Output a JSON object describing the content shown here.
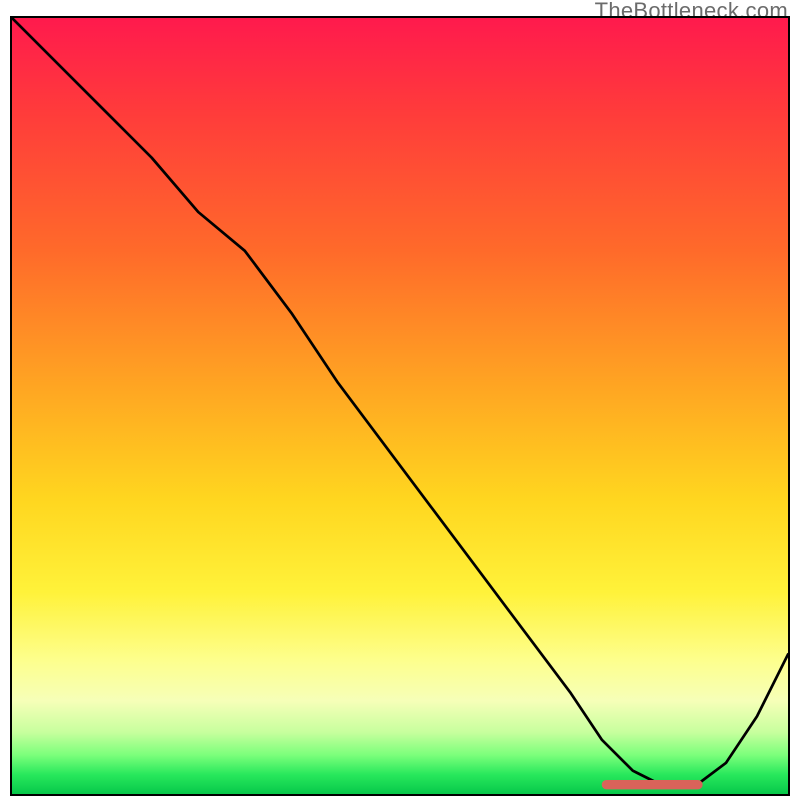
{
  "watermark": "TheBottleneck.com",
  "chart_data": {
    "type": "line",
    "title": "",
    "xlabel": "",
    "ylabel": "",
    "xlim": [
      0,
      100
    ],
    "ylim": [
      0,
      100
    ],
    "grid": false,
    "legend": false,
    "series": [
      {
        "name": "curve",
        "color": "#000000",
        "x": [
          0,
          6,
          12,
          18,
          24,
          30,
          36,
          42,
          48,
          54,
          60,
          66,
          72,
          76,
          80,
          84,
          88,
          92,
          96,
          100
        ],
        "y": [
          100,
          94,
          88,
          82,
          75,
          70,
          62,
          53,
          45,
          37,
          29,
          21,
          13,
          7,
          3,
          1,
          1,
          4,
          10,
          18
        ]
      }
    ],
    "marker_band": {
      "name": "highlight",
      "color": "#d9635a",
      "x_start": 76,
      "x_end": 89,
      "y": 1.2
    },
    "background_gradient": {
      "top": "#ff1a4d",
      "upper_mid": "#ffa722",
      "mid": "#fff23a",
      "lower": "#c8ff9e",
      "bottom": "#07c84a"
    }
  }
}
